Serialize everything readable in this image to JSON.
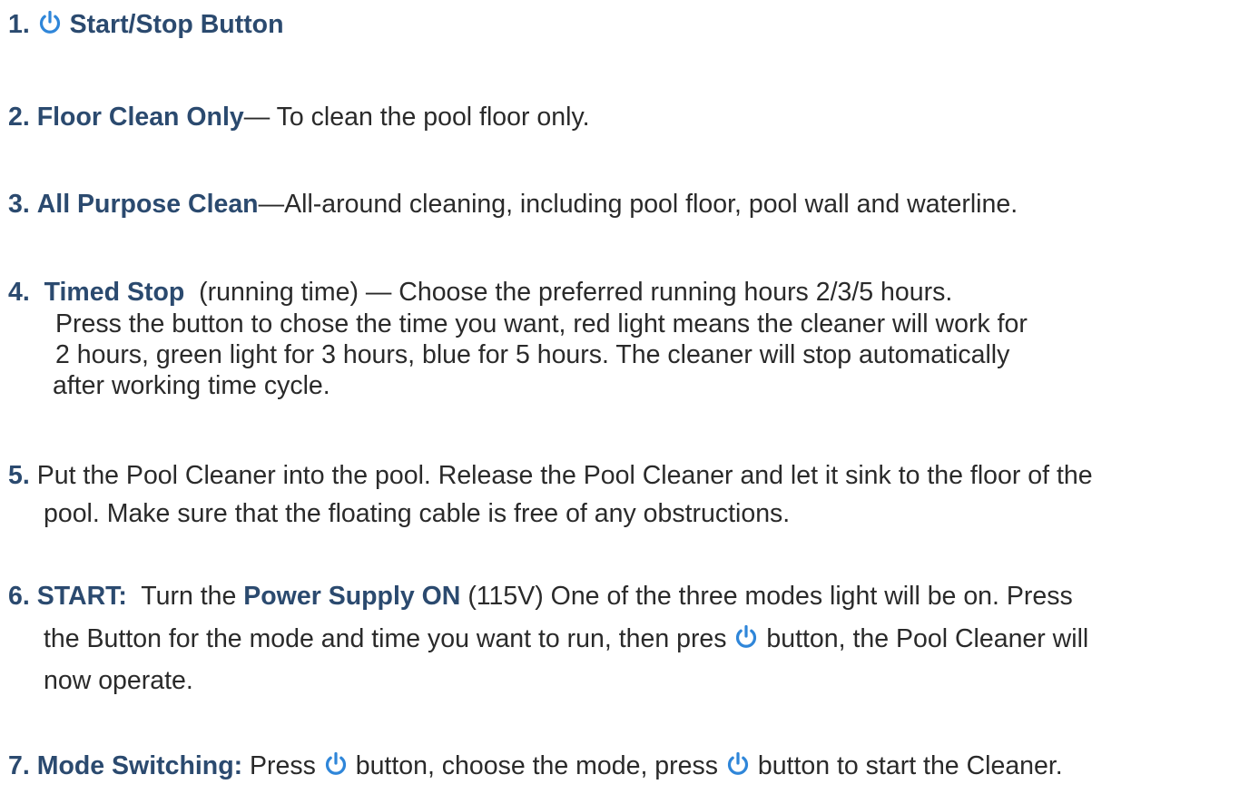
{
  "icon_color": "#2f86d9",
  "items": [
    {
      "number": "1.",
      "title": "Start/Stop Button",
      "icon": "power-icon"
    },
    {
      "number": "2.",
      "title": "Floor Clean Only",
      "description": "— To clean the pool floor only."
    },
    {
      "number": "3.",
      "title": "All Purpose Clean",
      "description": "—All-around cleaning, including pool floor, pool wall and waterline."
    },
    {
      "number": "4.",
      "title": "Timed Stop",
      "subtitle": "(running time) — Choose the preferred running hours 2/3/5 hours.",
      "lines": [
        "Press the button to chose the time you want, red light means the cleaner will work for",
        "2 hours, green light for 3 hours, blue for 5 hours. The cleaner will stop automatically",
        "after working time cycle."
      ]
    },
    {
      "number": "5.",
      "line1": "Put the Pool Cleaner into the pool. Release the Pool Cleaner and let it sink to the floor of the",
      "line2": "pool. Make sure that the floating cable is free of any obstructions."
    },
    {
      "number": "6.",
      "title": "START:",
      "text_a": "Turn the",
      "bold_b": "Power Supply ON",
      "text_c": "(115V) One of the three modes light will be on. Press",
      "line2_a": "the Button for the mode and time you want to run, then pres",
      "line2_b": "button, the Pool Cleaner will",
      "line3": "now operate."
    },
    {
      "number": "7.",
      "title": "Mode Switching:",
      "text_a": "Press",
      "text_b": "button, choose the mode, press",
      "text_c": "button to start the Cleaner."
    }
  ]
}
